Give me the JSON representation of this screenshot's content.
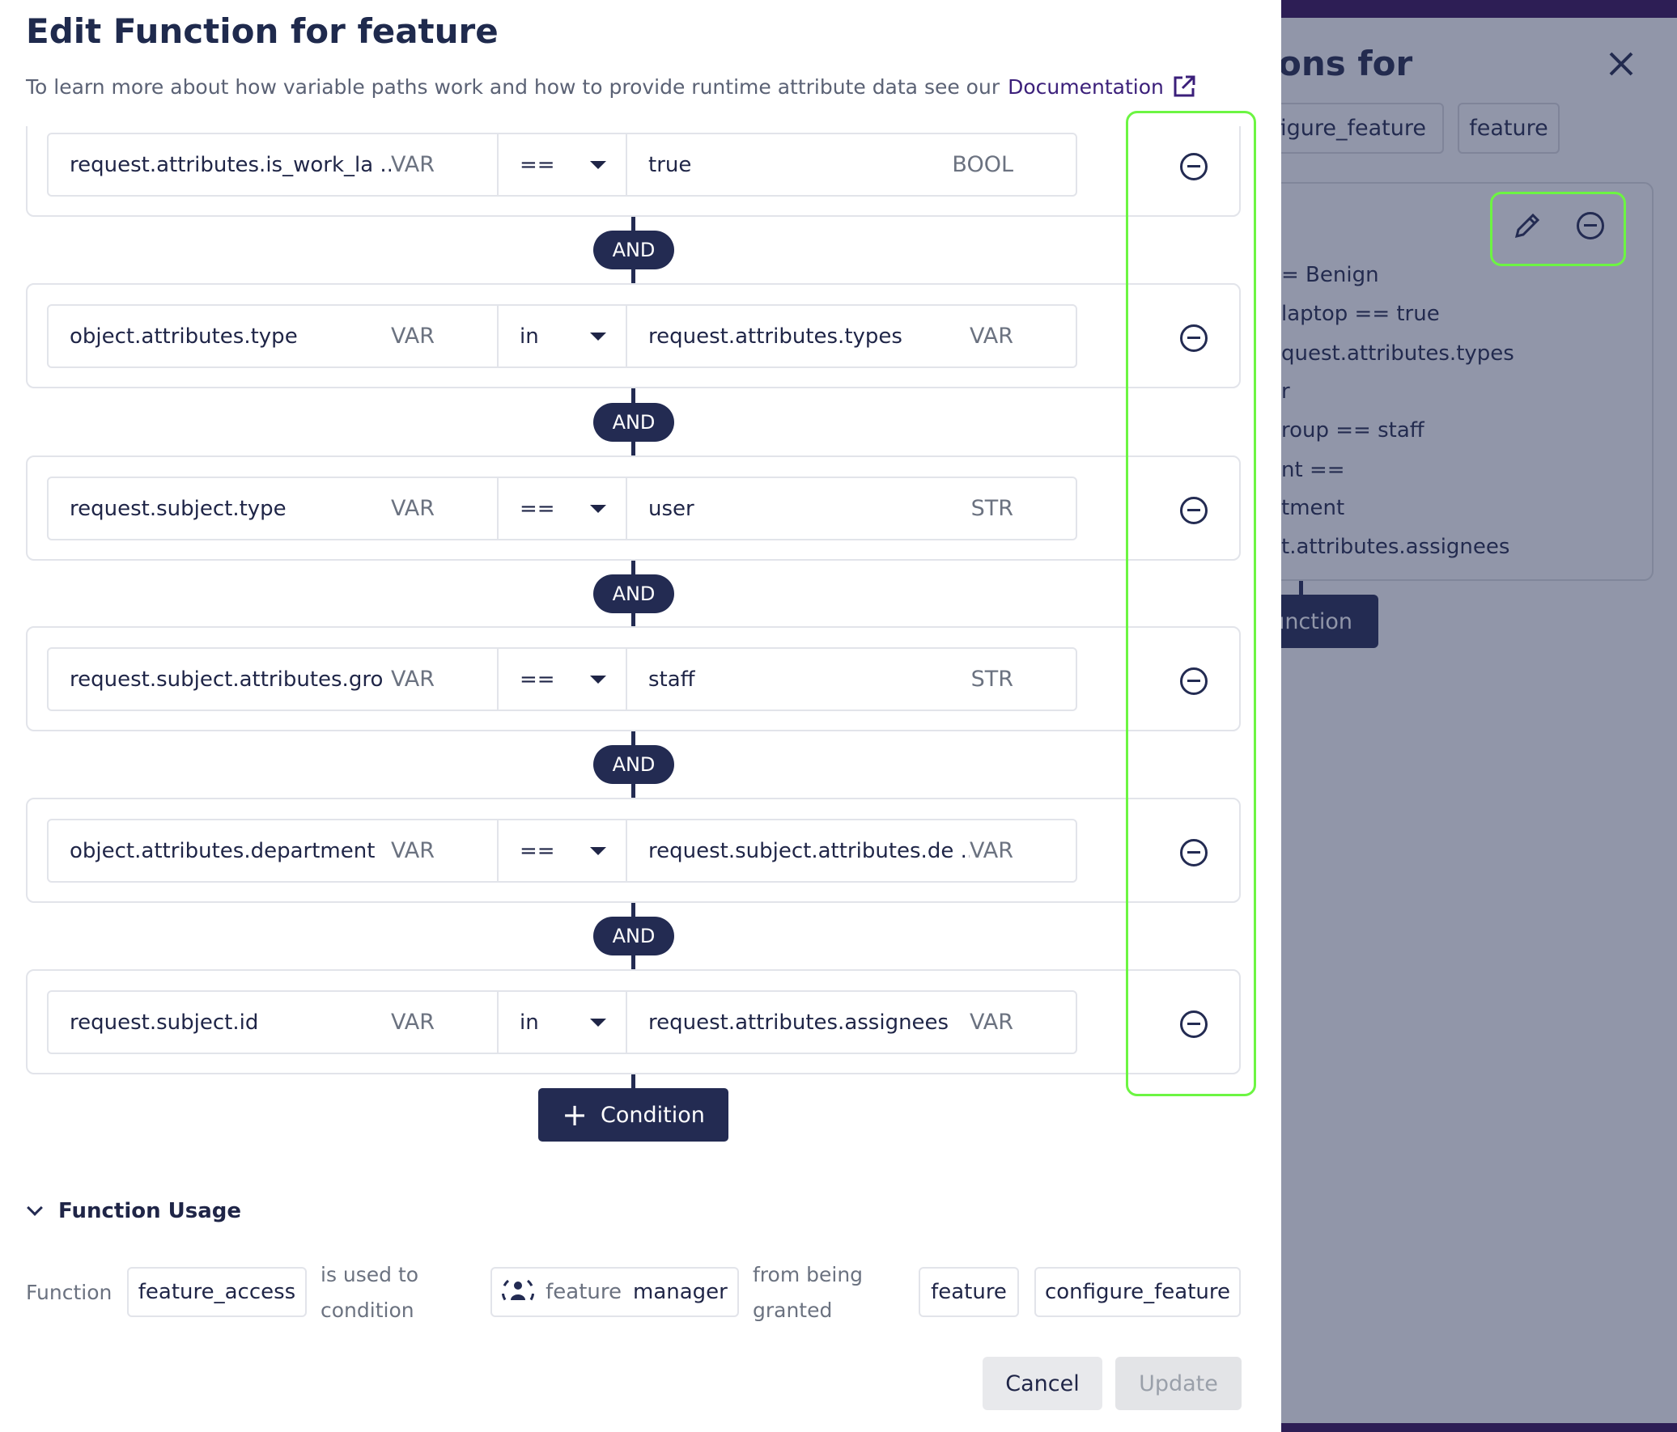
{
  "modal": {
    "title": "Edit Function for feature",
    "subtitle": "To learn more about how variable paths work and how to provide runtime attribute data see our",
    "doc_link": "Documentation",
    "conditions": [
      {
        "left": "request.attributes.is_work_la ...",
        "left_type": "VAR",
        "op": "==",
        "right": "true",
        "right_type": "BOOL"
      },
      {
        "left": "object.attributes.type",
        "left_type": "VAR",
        "op": "in",
        "right": "request.attributes.types",
        "right_type": "VAR"
      },
      {
        "left": "request.subject.type",
        "left_type": "VAR",
        "op": "==",
        "right": "user",
        "right_type": "STR"
      },
      {
        "left": "request.subject.attributes.gro ...",
        "left_type": "VAR",
        "op": "==",
        "right": "staff",
        "right_type": "STR"
      },
      {
        "left": "object.attributes.department",
        "left_type": "VAR",
        "op": "==",
        "right": "request.subject.attributes.de ...",
        "right_type": "VAR"
      },
      {
        "left": "request.subject.id",
        "left_type": "VAR",
        "op": "in",
        "right": "request.attributes.assignees",
        "right_type": "VAR"
      }
    ],
    "connector": "AND",
    "add_condition": "Condition",
    "usage": {
      "heading": "Function Usage",
      "function_label": "Function",
      "function_name": "feature_access",
      "used_to_1": "is used to",
      "used_to_2": "condition",
      "role_prefix": "feature",
      "role_name": "manager",
      "from_1": "from being",
      "from_2": "granted",
      "resource": "feature",
      "action": "configure_feature"
    },
    "cancel": "Cancel",
    "update": "Update"
  },
  "background": {
    "title_fragment": "ons for",
    "chips": [
      "nfigure_feature",
      "feature"
    ],
    "lines": [
      "= Benign",
      "laptop == true",
      "quest.attributes.types",
      "r",
      "roup == staff",
      "nt ==",
      "tment",
      "t.attributes.assignees"
    ],
    "button_fragment": "unction"
  },
  "colors": {
    "primary": "#232b52",
    "highlight": "#6cf542",
    "link": "#3b1f7a",
    "overlay": "#9196a9"
  }
}
